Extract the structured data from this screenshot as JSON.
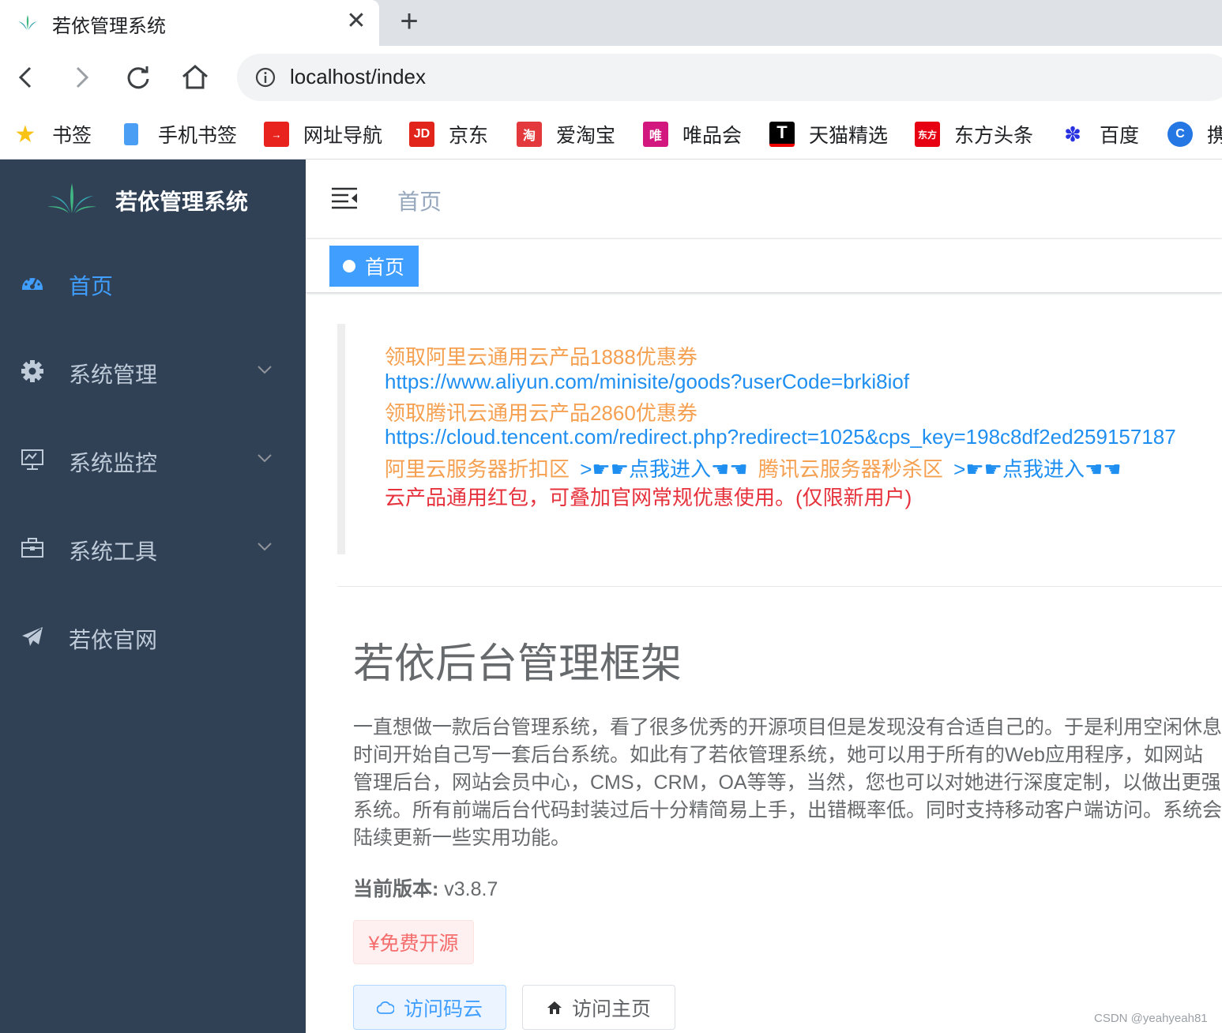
{
  "browser": {
    "tab_title": "若依管理系统",
    "url": "localhost/index",
    "bookmarks": [
      {
        "label": "书签",
        "icon": "star-icon"
      },
      {
        "label": "手机书签",
        "icon": "phone-icon"
      },
      {
        "label": "网址导航",
        "icon": "nav-site-icon"
      },
      {
        "label": "京东",
        "icon": "jd-icon"
      },
      {
        "label": "爱淘宝",
        "icon": "taobao-icon"
      },
      {
        "label": "唯品会",
        "icon": "vip-icon"
      },
      {
        "label": "天猫精选",
        "icon": "tmall-icon"
      },
      {
        "label": "东方头条",
        "icon": "dongfang-icon"
      },
      {
        "label": "百度",
        "icon": "baidu-icon"
      },
      {
        "label": "携",
        "icon": "ctrip-icon"
      }
    ]
  },
  "sidebar": {
    "title": "若依管理系统",
    "items": [
      {
        "label": "首页",
        "icon": "dashboard-icon",
        "active": true
      },
      {
        "label": "系统管理",
        "icon": "gear-icon"
      },
      {
        "label": "系统监控",
        "icon": "monitor-icon"
      },
      {
        "label": "系统工具",
        "icon": "toolbox-icon"
      },
      {
        "label": "若依官网",
        "icon": "paper-plane-icon"
      }
    ]
  },
  "header": {
    "breadcrumb": "首页",
    "active_tag": "首页"
  },
  "promo": {
    "aliyun_title": "领取阿里云通用云产品1888优惠券",
    "aliyun_url": "https://www.aliyun.com/minisite/goods?userCode=brki8iof",
    "tencent_title": "领取腾讯云通用云产品2860优惠券",
    "tencent_url": "https://cloud.tencent.com/redirect.php?redirect=1025&cps_key=198c8df2ed259157187",
    "aliyun_zone": "阿里云服务器折扣区",
    "aliyun_enter": ">☛☛点我进入☚☚",
    "tencent_zone": "腾讯云服务器秒杀区",
    "tencent_enter": ">☛☛点我进入☚☚",
    "notice": "云产品通用红包，可叠加官网常规优惠使用。(仅限新用户)"
  },
  "framework": {
    "title": "若依后台管理框架",
    "description": "一直想做一款后台管理系统，看了很多优秀的开源项目但是发现没有合适自己的。于是利用空闲休息时间开始自己写一套后台系统。如此有了若依管理系统，她可以用于所有的Web应用程序，如网站管理后台，网站会员中心，CMS，CRM，OA等等，当然，您也可以对她进行深度定制，以做出更强系统。所有前端后台代码封装过后十分精简易上手，出错概率低。同时支持移动客户端访问。系统会陆续更新一些实用功能。",
    "version_label": "当前版本:",
    "version_value": " v3.8.7",
    "free_tag": "¥免费开源",
    "gitee_button": "访问码云",
    "home_button": "访问主页"
  },
  "watermark": "CSDN @yeahyeah81",
  "colors": {
    "sidebar_bg": "#304156",
    "accent": "#409eff",
    "orange": "#f5a050",
    "link_blue": "#1e8ff0",
    "red": "#e6323c"
  }
}
